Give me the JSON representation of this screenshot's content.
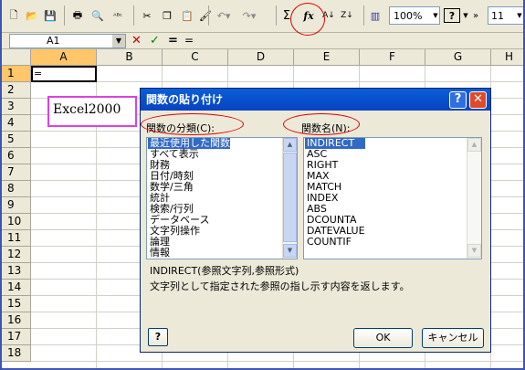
{
  "toolbar": {
    "zoom": "100%",
    "font_size": "11",
    "fx_label": "fx",
    "sum_label": "Σ"
  },
  "formula_bar": {
    "cell_ref": "A1",
    "cancel": "✕",
    "enter": "✓",
    "equals": "=",
    "content": "="
  },
  "sheet": {
    "columns": [
      "A",
      "B",
      "C",
      "D",
      "E",
      "F",
      "G",
      "H"
    ],
    "rows": [
      "1",
      "2",
      "3",
      "4",
      "5",
      "6",
      "7",
      "8",
      "9",
      "10",
      "11",
      "12",
      "13",
      "14",
      "15",
      "16",
      "17",
      "18"
    ],
    "a1_value": "=",
    "textbox": "Excel2000"
  },
  "dialog": {
    "title": "関数の貼り付け",
    "help_btn": "?",
    "close_btn": "✕",
    "category_label": "関数の分類(C):",
    "function_label": "関数名(N):",
    "categories": [
      "最近使用した関数",
      "すべて表示",
      "財務",
      "日付/時刻",
      "数学/三角",
      "統計",
      "検索/行列",
      "データベース",
      "文字列操作",
      "論理",
      "情報"
    ],
    "functions": [
      "INDIRECT",
      "ASC",
      "RIGHT",
      "MAX",
      "MATCH",
      "INDEX",
      "ABS",
      "DCOUNTA",
      "DATEVALUE",
      "COUNTIF"
    ],
    "syntax": "INDIRECT(参照文字列,参照形式)",
    "description": "文字列として指定された参照の指し示す内容を返します。",
    "ok": "OK",
    "cancel": "キャンセル",
    "help_icon": "?"
  },
  "colors": {
    "title_bar": "#0a5fd8",
    "selection": "#316ac5",
    "annotation": "#e00000",
    "textbox_border": "#e040e0"
  }
}
